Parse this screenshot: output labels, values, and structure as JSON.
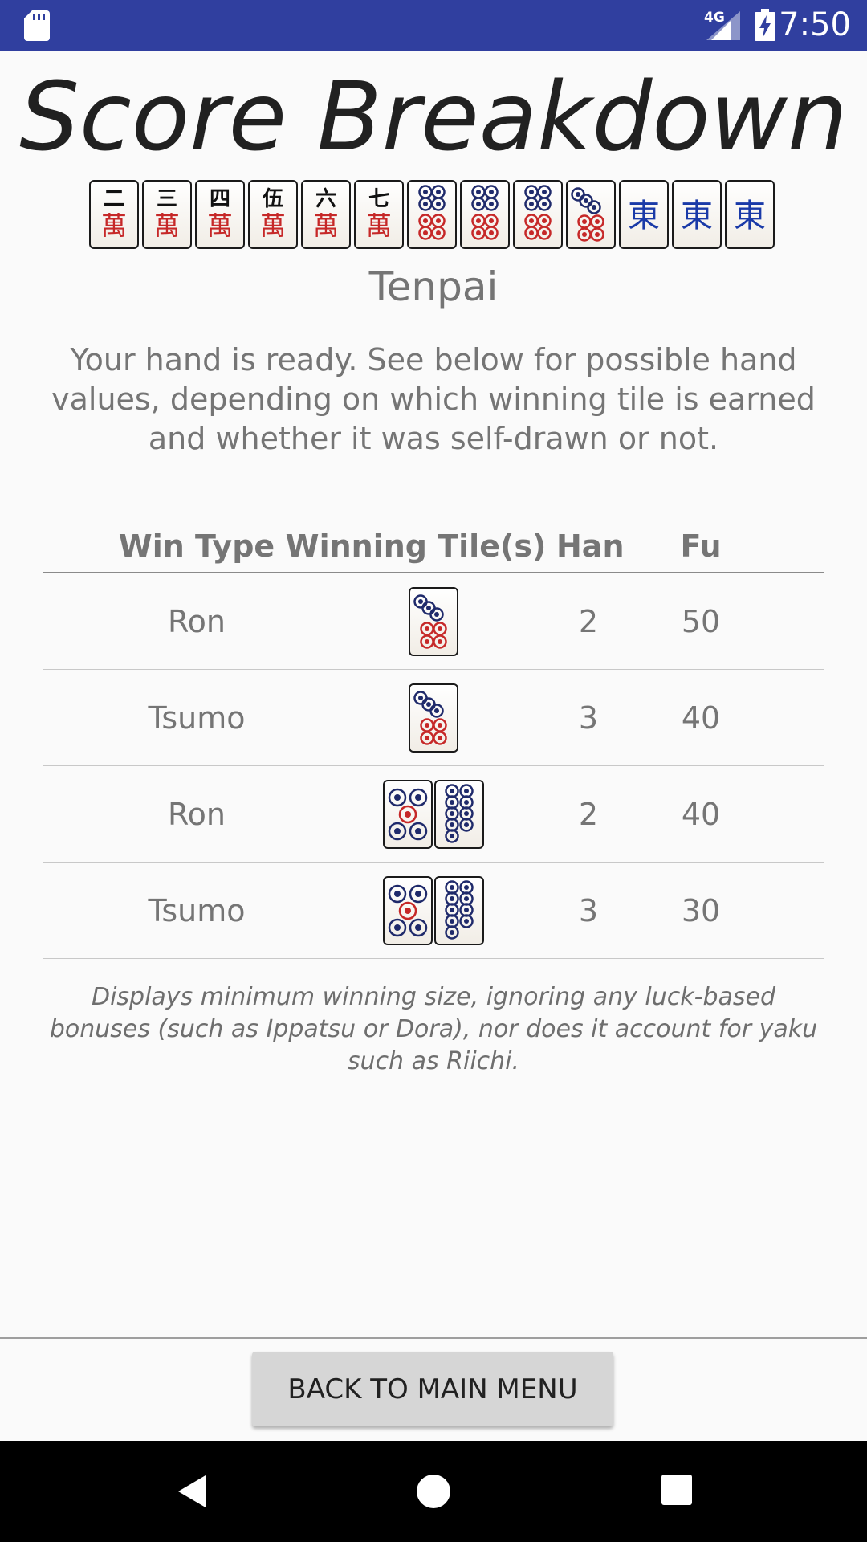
{
  "status_bar": {
    "time": "7:50",
    "network": "4G",
    "icons": [
      "sd-card-icon",
      "signal-icon",
      "battery-charging-icon"
    ]
  },
  "title": "Score Breakdown",
  "hand": {
    "tiles": [
      "2-man",
      "3-man",
      "4-man",
      "5-man",
      "6-man",
      "7-man",
      "8-pin",
      "8-pin",
      "8-pin",
      "7-pin",
      "east",
      "east",
      "east"
    ]
  },
  "subtitle": "Tenpai",
  "description": "Your hand is ready. See below for possible hand values, depending on which winning tile is earned and whether it was self-drawn or not.",
  "table": {
    "headers": {
      "win_type": "Win Type",
      "winning_tiles": "Winning Tile(s)",
      "han": "Han",
      "fu": "Fu"
    },
    "rows": [
      {
        "win_type": "Ron",
        "tiles": [
          "7-pin"
        ],
        "han": "2",
        "fu": "50"
      },
      {
        "win_type": "Tsumo",
        "tiles": [
          "7-pin"
        ],
        "han": "3",
        "fu": "40"
      },
      {
        "win_type": "Ron",
        "tiles": [
          "5-pin",
          "9-pin"
        ],
        "han": "2",
        "fu": "40"
      },
      {
        "win_type": "Tsumo",
        "tiles": [
          "5-pin",
          "9-pin"
        ],
        "han": "3",
        "fu": "30"
      }
    ]
  },
  "footnote": "Displays minimum winning size, ignoring any luck-based bonuses (such as Ippatsu or Dora), nor does it account for yaku such as Riichi.",
  "back_button": "BACK TO MAIN MENU",
  "nav_bar": {
    "icons": [
      "back-icon",
      "home-icon",
      "recents-icon"
    ]
  },
  "colors": {
    "status_bar": "#303f9f",
    "background": "#fafafa",
    "pin_blue": "#1f2a6b",
    "pin_red": "#c62828",
    "east_blue": "#1a3aa8"
  }
}
